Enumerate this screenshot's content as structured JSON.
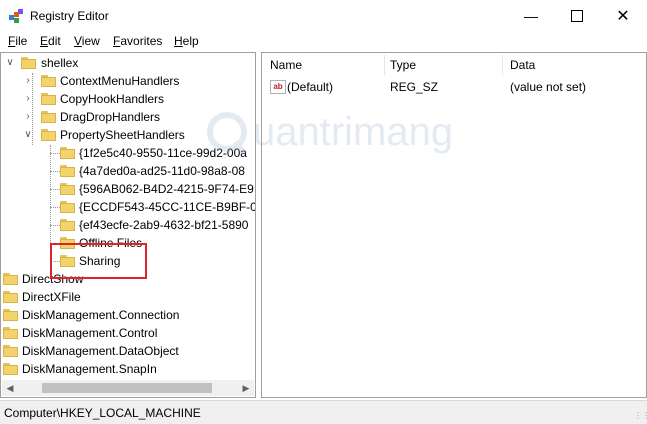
{
  "window": {
    "title": "Registry Editor",
    "icon": "registry-editor-icon"
  },
  "menu": [
    {
      "label": "F",
      "rest": "ile"
    },
    {
      "label": "E",
      "rest": "dit"
    },
    {
      "label": "V",
      "rest": "iew"
    },
    {
      "label": "F",
      "rest": "avorites",
      "prefix": ""
    },
    {
      "label": "H",
      "rest": "elp"
    }
  ],
  "tree": {
    "items": [
      {
        "label": "shellex",
        "expanded": true
      },
      {
        "label": "ContextMenuHandlers"
      },
      {
        "label": "CopyHookHandlers"
      },
      {
        "label": "DragDropHandlers"
      },
      {
        "label": "PropertySheetHandlers",
        "expanded": true
      },
      {
        "label": "{1f2e5c40-9550-11ce-99d2-00a"
      },
      {
        "label": "{4a7ded0a-ad25-11d0-98a8-08"
      },
      {
        "label": "{596AB062-B4D2-4215-9F74-E9"
      },
      {
        "label": "{ECCDF543-45CC-11CE-B9BF-0"
      },
      {
        "label": "{ef43ecfe-2ab9-4632-bf21-5890"
      },
      {
        "label": "Offline Files"
      },
      {
        "label": "Sharing"
      },
      {
        "label": "DirectShow"
      },
      {
        "label": "DirectXFile"
      },
      {
        "label": "DiskManagement.Connection"
      },
      {
        "label": "DiskManagement.Control"
      },
      {
        "label": "DiskManagement.DataObject"
      },
      {
        "label": "DiskManagement.SnapIn"
      }
    ]
  },
  "list": {
    "columns": [
      "Name",
      "Type",
      "Data"
    ],
    "rows": [
      {
        "icon": "ab",
        "name": "(Default)",
        "type": "REG_SZ",
        "data": "(value not set)"
      }
    ]
  },
  "watermark": {
    "text": "uantrimang"
  },
  "status": {
    "path": "Computer\\HKEY_LOCAL_MACHINE"
  },
  "colors": {
    "highlight_border": "#e0232b",
    "folder": "#f3d46b"
  }
}
